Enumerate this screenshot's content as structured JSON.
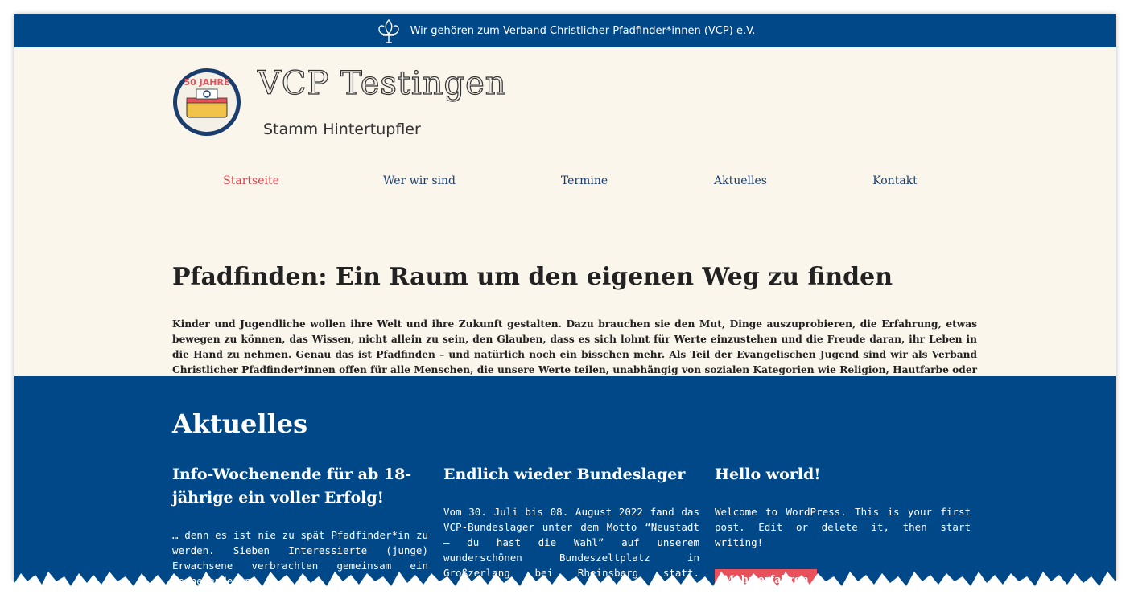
{
  "topbar": {
    "text": "Wir gehören zum Verband Christlicher Pfadfinder*innen (VCP) e.V.",
    "icon": "fleur-de-lis-icon"
  },
  "header": {
    "logo_badge": "50 JAHRE",
    "title": "VCP Testingen",
    "subtitle": "Stamm Hintertupfler"
  },
  "nav": {
    "items": [
      {
        "label": "Startseite"
      },
      {
        "label": "Wer wir sind"
      },
      {
        "label": "Termine"
      },
      {
        "label": "Aktuelles"
      },
      {
        "label": "Kontakt"
      }
    ]
  },
  "hero": {
    "heading": "Pfadfinden: Ein Raum um den eigenen Weg zu finden",
    "paragraph": "Kinder und Jugendliche wollen ihre Welt und ihre Zukunft gestalten. Dazu brauchen sie den Mut, Dinge auszuprobieren, die Erfahrung, etwas bewegen zu können, das Wissen, nicht allein zu sein, den Glauben, dass es sich lohnt für Werte einzustehen und die Freude daran, ihr Leben in die Hand zu nehmen. Genau das ist Pfadfinden – und natürlich noch ein bisschen mehr. Als Teil der Evangelischen Jugend sind wir als Verband Christlicher Pfadfinder*innen offen für alle Menschen, die unsere Werte teilen, unabhängig von sozialen Kategorien wie Religion, Hautfarbe oder Geschlecht."
  },
  "news": {
    "title": "Aktuelles",
    "posts": [
      {
        "title": "Info-Wochenende für ab 18-jährige ein voller Erfolg!",
        "excerpt": "… denn es ist nie zu spät Pfadfinder*in zu werden. Sieben Interessierte (junge) Erwachsene verbrachten gemeinsam ein Wochenende in"
      },
      {
        "title": "Endlich wieder Bundeslager",
        "excerpt": "Vom 30. Juli bis 08. August 2022 fand das VCP-Bundeslager unter dem Motto “Neustadt – du hast die Wahl” auf unserem wunderschönen Bundeszeltplatz in Großzerlang bei Rheinsberg statt. Gemeinsam haben wir"
      },
      {
        "title": "Hello world!",
        "excerpt": "Welcome to WordPress. This is your first post. Edit or delete it, then start writing!",
        "button": "Mehr erfahren"
      }
    ]
  },
  "colors": {
    "brand_blue": "#004887",
    "cream": "#fbf6ec",
    "nav_active": "#d8424f",
    "nav_link": "#1b3d6e",
    "button": "#e8505b"
  }
}
